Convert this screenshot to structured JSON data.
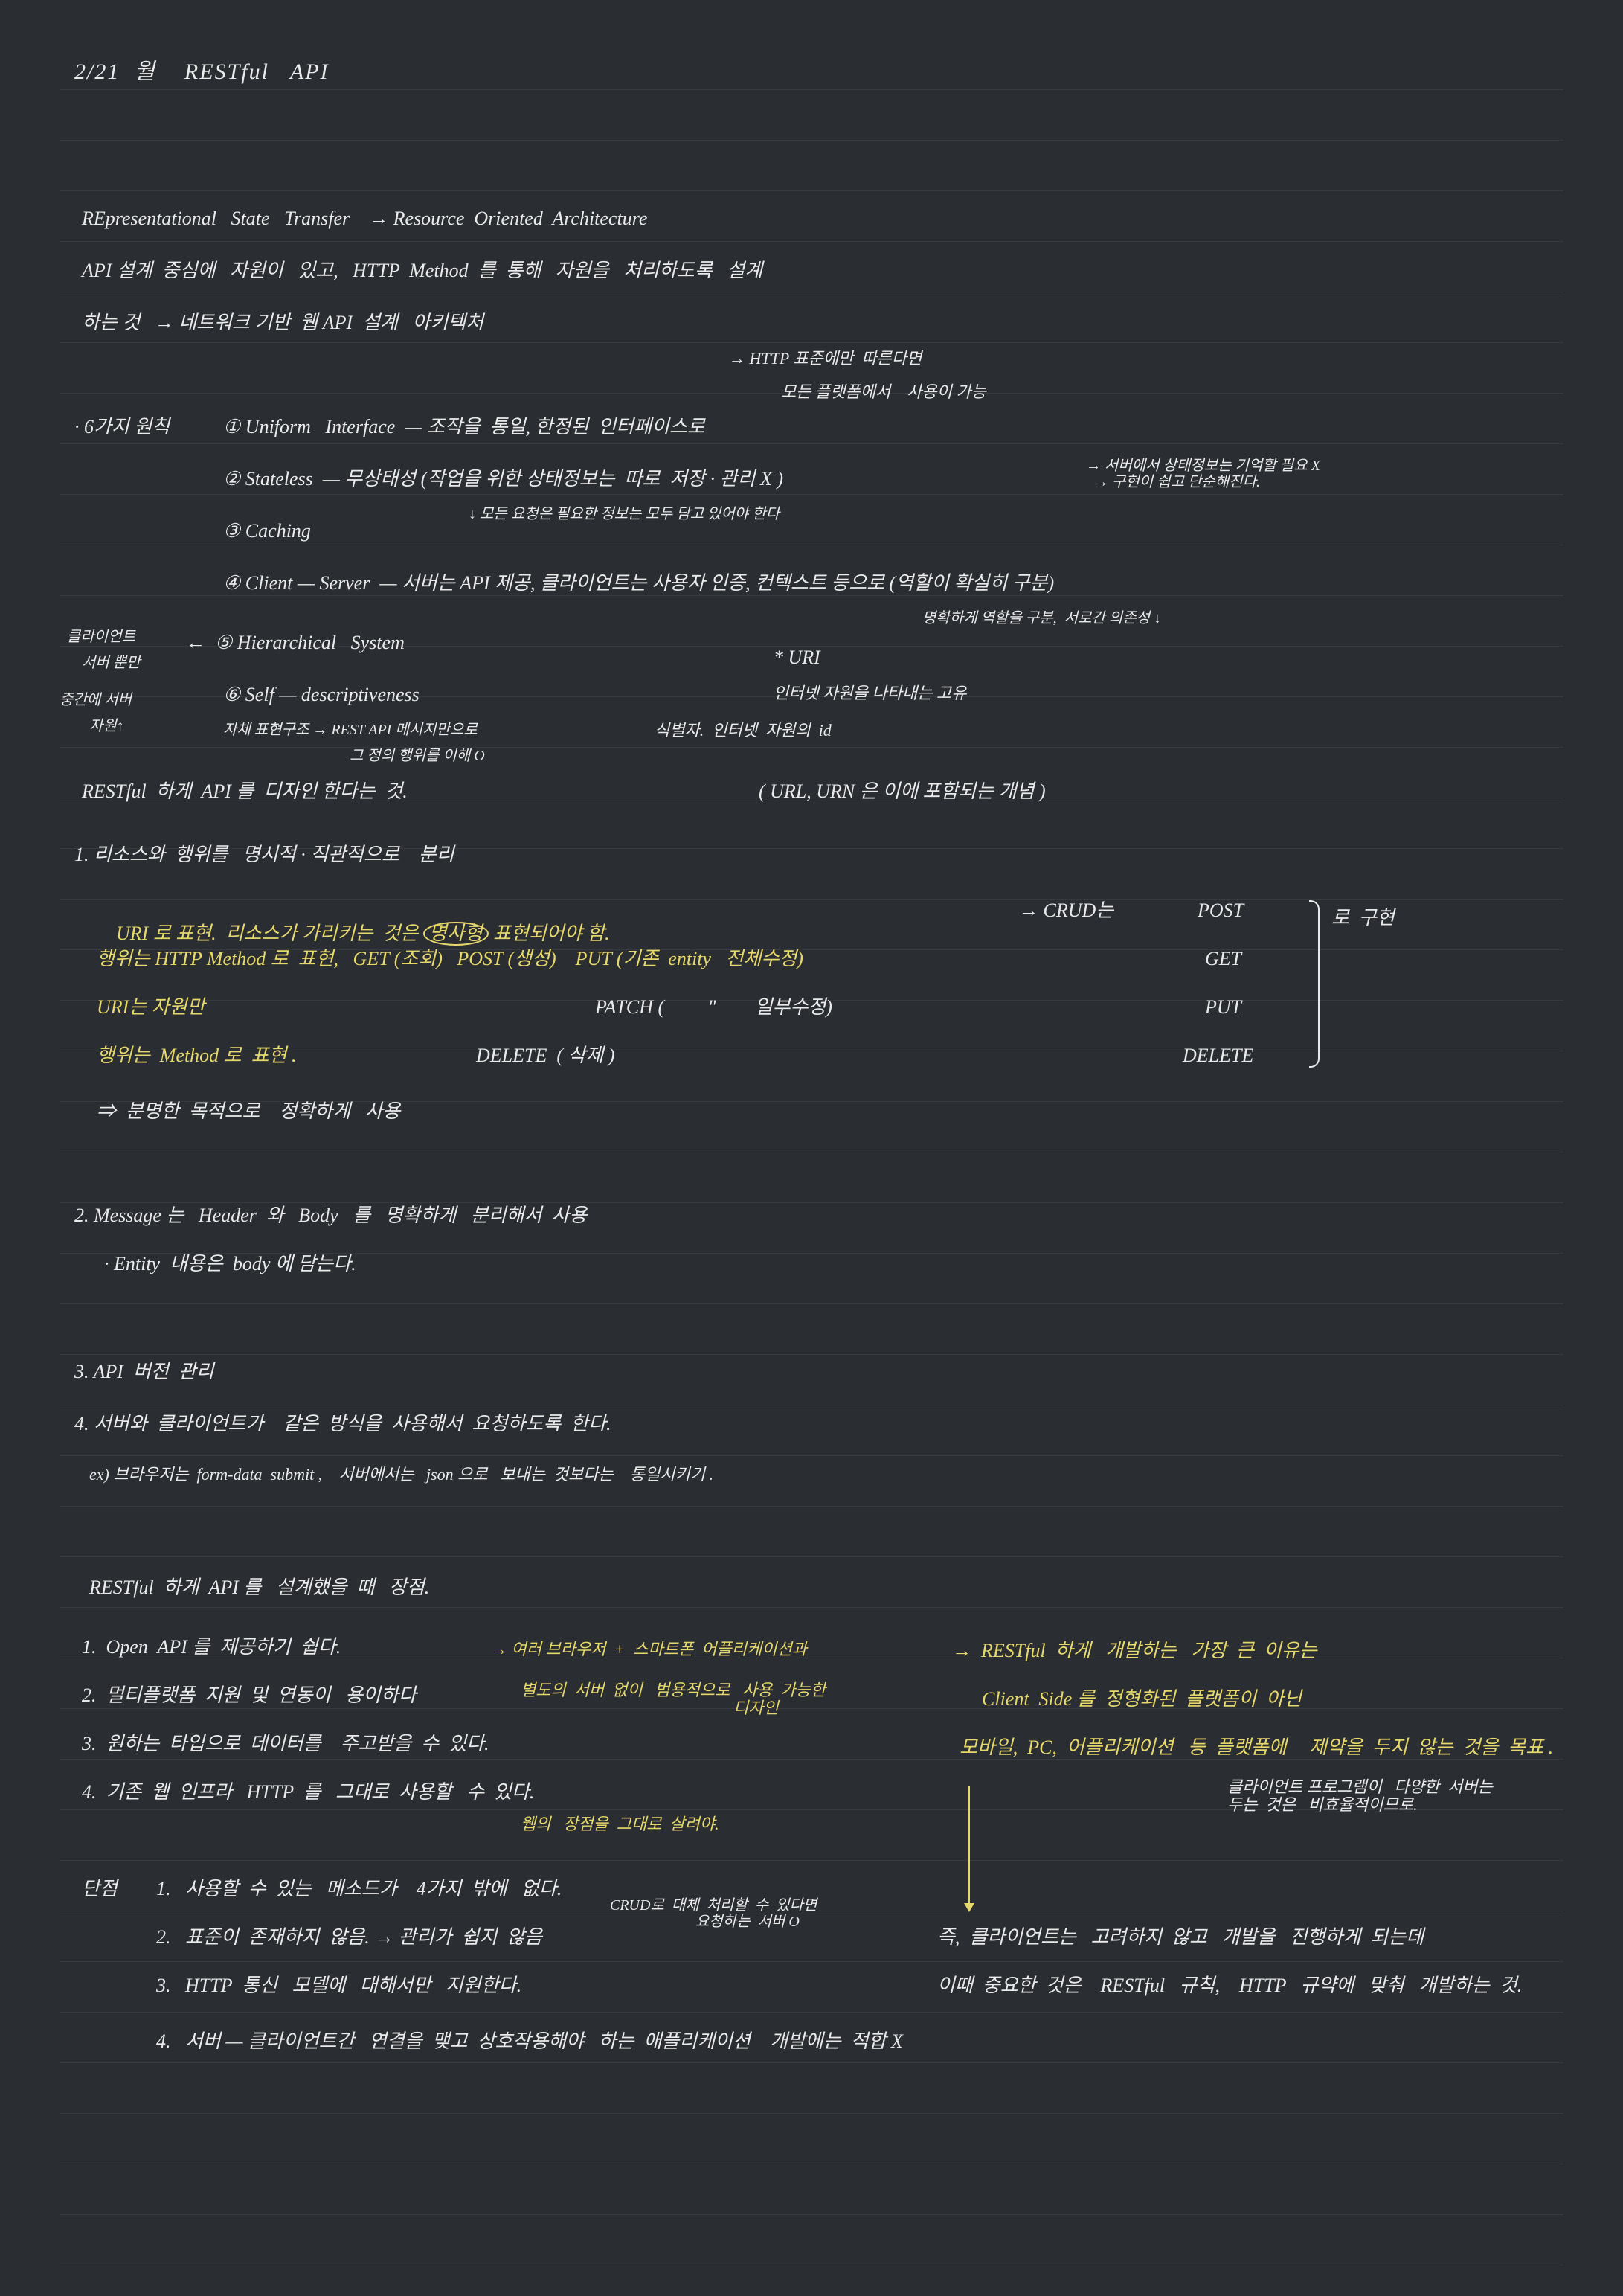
{
  "page": {
    "date_title": "2/21  월    RESTful   API",
    "def1": "REpresentational   State   Transfer    → Resource  Oriented  Architecture",
    "def2": "API 설계  중심에   자원이   있고,   HTTP  Method  를  통해   자원을   처리하도록   설계",
    "def3": "하는 것   → 네트워크 기반  웹 API  설계   아키텍처",
    "note_http1": "→ HTTP 표준에만  따른다면",
    "note_http2": "모든 플랫폼에서    사용이 가능",
    "six_label": "· 6가지 원칙",
    "p1": "① Uniform   Interface  — 조작을  통일, 한정된  인터페이스로",
    "p2": "② Stateless  — 무상태성 (작업을 위한 상태정보는  따로  저장 · 관리 X )",
    "p2_note": "→ 서버에서 상태정보는 기억할 필요 X\n  → 구현이 쉽고 단순해진다.",
    "p2_sub": "↓ 모든 요청은 필요한 정보는 모두 담고 있어야 한다",
    "p3": "③ Caching",
    "p4": "④ Client — Server  — 서버는 API 제공, 클라이언트는 사용자 인증, 컨텍스트 등으로 (역할이 확실히 구분)",
    "p4_sub": "명확하게 역할을 구분,  서로간 의존성 ↓",
    "p5_left1": "클라이언트",
    "p5_left2": "서버 뿐만",
    "p5": "←  ⑤ Hierarchical   System",
    "p6_left1": "중간에 서버",
    "p6_left2": "자원↑",
    "p6": "⑥ Self — descriptiveness",
    "p6_sub1": "자체 표현구조 → REST API 메시지만으로",
    "p6_sub2": "그 정의 행위를 이해 O",
    "uri_label": "* URI",
    "uri_sub1": "인터넷 자원을 나타내는 고유",
    "uri_sub2": "식별자.  인터넷  자원의  id",
    "restful_line": "RESTful  하게  API 를  디자인 한다는  것.",
    "url_urn": "( URL, URN 은 이에 포함되는 개념 )",
    "s1_h": "1. 리소스와  행위를   명시적 · 직관적으로    분리",
    "s1_1": "URI 로 표현.  리소스가 가리키는  것은",
    "s1_1_circ": "명사형",
    "s1_1_end": "표현되어야 함.",
    "s1_2": "행위는 HTTP Method 로  표현,   GET (조회)   POST (생성)    PUT (기존  entity   전체수정)",
    "s1_3": "URI는 자원만",
    "s1_patch": "PATCH (         \"        일부수정)",
    "s1_4": "행위는  Method 로  표현 .",
    "s1_delete": "DELETE  ( 삭제 )",
    "s1_arrow": "⇒  분명한  목적으로    정확하게   사용",
    "crud_label": "→ CRUD는",
    "crud_post": "POST",
    "crud_get": "GET",
    "crud_put": "PUT",
    "crud_delete": "DELETE",
    "crud_end": "로  구현",
    "s2_h": "2. Message 는   Header  와   Body   를   명확하게   분리해서  사용",
    "s2_1": "· Entity  내용은  body 에 담는다.",
    "s3_h": "3. API  버전  관리",
    "s4_h": "4. 서버와  클라이언트가    같은  방식을  사용해서  요청하도록  한다.",
    "s4_ex": "ex) 브라우저는  form-data  submit ,    서버에서는   json 으로   보내는  것보다는    통일시키기 .",
    "adv_h": "RESTful  하게  API 를   설계했을  때   장점.",
    "adv_1": "1.  Open  API 를  제공하기  쉽다.",
    "adv_2": "2.  멀티플랫폼  지원  및  연동이   용이하다",
    "adv_2_note1": "→ 여러 브라우저  +  스마트폰  어플리케이션과",
    "adv_2_note2": "별도의  서버  없이   범용적으로   사용  가능한\n                                                    디자인",
    "adv_3": "3.  원하는  타입으로  데이터를    주고받을  수  있다.",
    "adv_4": "4.  기존  웹  인프라   HTTP  를   그대로  사용할   수  있다.",
    "adv_4_note": "웹의   장점을  그대로  살려야.",
    "right_1": "→  RESTful  하게   개발하는   가장  큰  이유는",
    "right_2": "Client  Side 를  정형화된  플랫폼이  아닌",
    "right_3": "모바일,  PC,  어플리케이션   등  플랫폼에",
    "right_3b": "제약을  두지  않는  것을  목표 .",
    "right_4": "클라이언트 프로그램이   다양한  서버는\n두는  것은   비효율적이므로.",
    "right_5": "즉,  클라이언트는   고려하지  않고   개발을   진행하게  되는데",
    "right_6": "이때  중요한  것은    RESTful   규칙,    HTTP   규약에   맞춰   개발하는  것.",
    "dis_h": "단점",
    "dis_1": "1.   사용할  수  있는   메소드가    4가지  밖에   없다.",
    "dis_1_note": "CRUD로  대체  처리할  수  있다면\n                       요청하는  서버 O",
    "dis_2": "2.   표준이  존재하지  않음. → 관리가  쉽지  않음",
    "dis_3": "3.   HTTP  통신   모델에   대해서만   지원한다.",
    "dis_4": "4.   서버 — 클라이언트간   연결을  맺고  상호작용해야   하는  애플리케이션    개발에는  적합 X"
  }
}
